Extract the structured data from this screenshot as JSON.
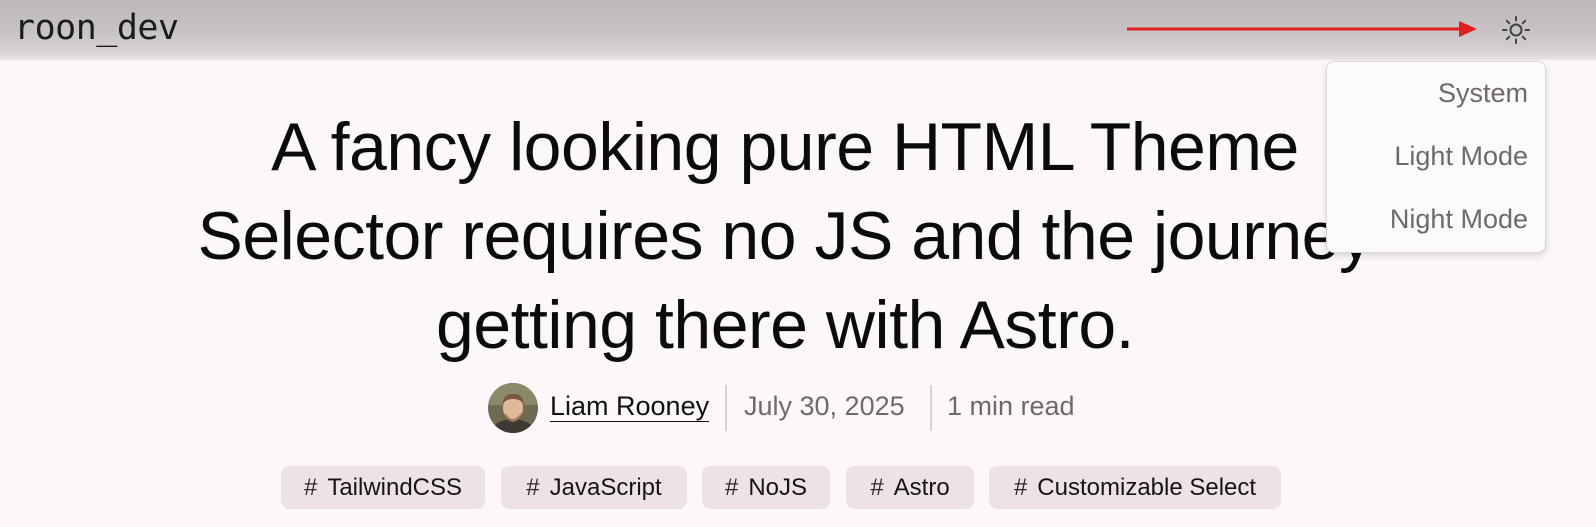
{
  "header": {
    "brand": "roon_dev",
    "theme_icon": "sun-icon"
  },
  "theme_menu": {
    "items": [
      "System",
      "Light Mode",
      "Night Mode"
    ]
  },
  "annotation": {
    "color": "#e02020"
  },
  "article": {
    "title": "A fancy looking pure HTML Theme Selector requires no JS and the journey getting there with Astro.",
    "author": "Liam Rooney",
    "date": "July 30, 2025",
    "read_time": "1 min read",
    "tags": [
      "TailwindCSS",
      "JavaScript",
      "NoJS",
      "Astro",
      "Customizable Select"
    ]
  },
  "colors": {
    "background": "#fcf8f9",
    "tag_background": "#ede3e6",
    "muted_text": "#6e6a6c"
  }
}
